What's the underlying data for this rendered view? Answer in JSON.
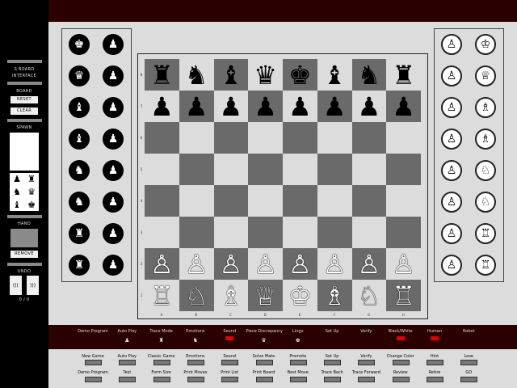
{
  "sidebar": {
    "title_line1": "S BOARD",
    "title_line2": "INTERFACE",
    "board_label": "BOARD",
    "reset_label": "RESET",
    "clear_label": "CLEAR",
    "spawn_label": "SPAWN",
    "spawn_white": [
      "♙",
      "♖",
      "♘",
      "♕",
      "♗",
      "♔"
    ],
    "spawn_black": [
      "♟",
      "♜",
      "♞",
      "♛",
      "♝",
      "♚"
    ],
    "hand_label": "HAND",
    "remove_label": "REMOVE",
    "undo_label": "UNDO",
    "undo_back": "(((",
    "undo_fwd": ")))",
    "undo_count": "0 / 0"
  },
  "captured_left": {
    "pieces": [
      "♚",
      "♟",
      "♛",
      "♟",
      "♝",
      "♟",
      "♝",
      "♟",
      "♞",
      "♟",
      "♞",
      "♟",
      "♜",
      "♟",
      "♜",
      "♟"
    ]
  },
  "captured_right": {
    "pieces": [
      "♙",
      "♔",
      "♙",
      "♕",
      "♙",
      "♗",
      "♙",
      "♗",
      "♙",
      "♘",
      "♙",
      "♘",
      "♙",
      "♖",
      "♙",
      "♖"
    ]
  },
  "board": {
    "ranks": [
      "8",
      "7",
      "6",
      "5",
      "4",
      "3",
      "2",
      "1"
    ],
    "files": [
      "A",
      "B",
      "C",
      "D",
      "E",
      "F",
      "G",
      "H"
    ],
    "rows": [
      [
        "♜",
        "♞",
        "♝",
        "♛",
        "♚",
        "♝",
        "♞",
        "♜"
      ],
      [
        "♟",
        "♟",
        "♟",
        "♟",
        "♟",
        "♟",
        "♟",
        "♟"
      ],
      [
        "",
        "",
        "",
        "",
        "",
        "",
        "",
        ""
      ],
      [
        "",
        "",
        "",
        "",
        "",
        "",
        "",
        ""
      ],
      [
        "",
        "",
        "",
        "",
        "",
        "",
        "",
        ""
      ],
      [
        "",
        "",
        "",
        "",
        "",
        "",
        "",
        ""
      ],
      [
        "♙",
        "♙",
        "♙",
        "♙",
        "♙",
        "♙",
        "♙",
        "♙"
      ],
      [
        "♖",
        "♘",
        "♗",
        "♕",
        "♔",
        "♗",
        "♘",
        "♖"
      ]
    ]
  },
  "modes": [
    {
      "label": "Demo Program",
      "state": ""
    },
    {
      "label": "Auto Play",
      "state": "♟"
    },
    {
      "label": "Trace Mode",
      "state": "♜"
    },
    {
      "label": "Emotions",
      "state": "♞"
    },
    {
      "label": "Sound",
      "state": "on"
    },
    {
      "label": "Piece Discrepancy",
      "state": "♛"
    },
    {
      "label": "Lingo",
      "state": "♚"
    },
    {
      "label": "Set Up",
      "state": ""
    },
    {
      "label": "Verify",
      "state": ""
    },
    {
      "label": "Black/White",
      "state": "on"
    },
    {
      "label": "Human",
      "state": "on"
    },
    {
      "label": "Robot",
      "state": ""
    }
  ],
  "buttons_row1": [
    "New Game",
    "Auto Play",
    "Classic Game",
    "Emotions",
    "Sound",
    "Solve Mate",
    "Promote",
    "Set Up",
    "Verify",
    "Change Color",
    "Hint",
    "Lose"
  ],
  "buttons_row2": [
    "Demo Program",
    "Test",
    "Form Size",
    "Print Moves",
    "Print List",
    "Print Board",
    "Best Move",
    "Trace Back",
    "Trace Forward",
    "Review",
    "Retire",
    "GO"
  ],
  "colors": {
    "background": "#dcdcdc",
    "dark_square": "#6a6a6a",
    "light_square": "#dcdcdc",
    "control_bar": "#2a0000",
    "indicator_on": "#e00000"
  }
}
